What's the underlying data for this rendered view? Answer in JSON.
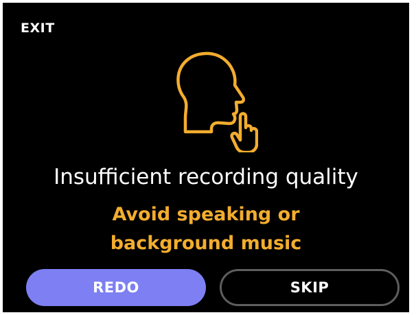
{
  "header": {
    "exit_label": "EXIT"
  },
  "icon": {
    "name": "speaking-head-hush-icon",
    "color": "#f3ad2e"
  },
  "message": {
    "title": "Insufficient recording quality",
    "subtitle_line1": "Avoid speaking or",
    "subtitle_line2": "background music"
  },
  "buttons": {
    "redo_label": "REDO",
    "skip_label": "SKIP"
  },
  "colors": {
    "background": "#000000",
    "accent": "#f3ad2e",
    "primary_button": "#7d7ff2",
    "secondary_border": "#5e5e5e",
    "text": "#ffffff"
  }
}
